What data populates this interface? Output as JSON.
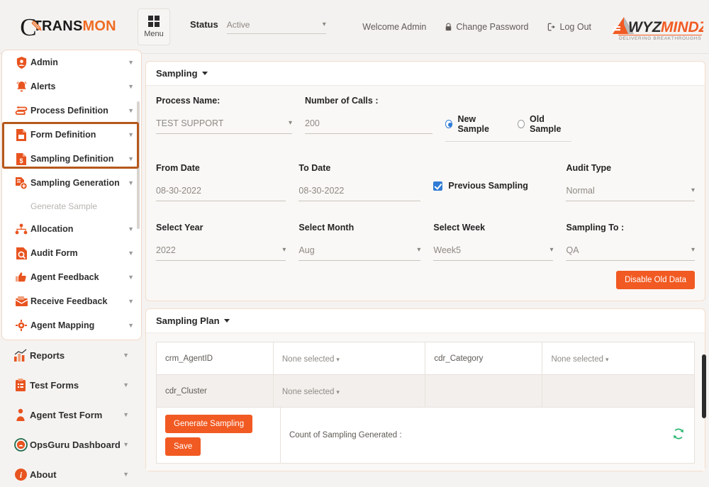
{
  "header": {
    "logo": {
      "mark": "C",
      "text_dark": "TRANS",
      "text_accent": "MON"
    },
    "menu_label": "Menu",
    "status_label": "Status",
    "status_value": "Active",
    "welcome": "Welcome Admin",
    "change_password": "Change Password",
    "log_out": "Log Out",
    "brand_logo": {
      "name_dark": "WYZ",
      "name_accent": "MINDZ",
      "tagline": "DELIVERING  BREAKTHROUGHS"
    }
  },
  "sidebar": {
    "items": [
      {
        "label": "Admin",
        "icon": "shield-user-icon"
      },
      {
        "label": "Alerts",
        "icon": "bell-icon"
      },
      {
        "label": "Process Definition",
        "icon": "process-arrows-icon"
      },
      {
        "label": "Form Definition",
        "icon": "form-document-icon"
      },
      {
        "label": "Sampling Definition",
        "icon": "dollar-document-icon"
      },
      {
        "label": "Sampling Generation",
        "icon": "document-plus-icon"
      },
      {
        "label": "Allocation",
        "icon": "hierarchy-icon"
      },
      {
        "label": "Audit Form",
        "icon": "audit-magnifier-icon"
      },
      {
        "label": "Agent Feedback",
        "icon": "thumbs-up-icon"
      },
      {
        "label": "Receive Feedback",
        "icon": "inbox-feedback-icon"
      },
      {
        "label": "Agent Mapping",
        "icon": "gear-icon"
      }
    ],
    "sub_item": "Generate Sample",
    "lower_items": [
      {
        "label": "Reports",
        "icon": "bar-chart-icon"
      },
      {
        "label": "Test Forms",
        "icon": "clipboard-check-icon"
      },
      {
        "label": "Agent Test Form",
        "icon": "person-icon"
      },
      {
        "label": "OpsGuru Dashboard",
        "icon": "dashboard-circle-icon"
      },
      {
        "label": "About",
        "icon": "info-icon"
      }
    ]
  },
  "sampling": {
    "panel_title": "Sampling",
    "process_name": {
      "label": "Process Name:",
      "value": "TEST SUPPORT"
    },
    "number_of_calls": {
      "label": "Number of Calls :",
      "value": "200"
    },
    "sample_type": {
      "new_label": "New Sample",
      "old_label": "Old Sample",
      "selected": "New Sample"
    },
    "from_date": {
      "label": "From Date",
      "value": "08-30-2022"
    },
    "to_date": {
      "label": "To Date",
      "value": "08-30-2022"
    },
    "previous_sampling": {
      "label": "Previous Sampling",
      "checked": true
    },
    "audit_type": {
      "label": "Audit Type",
      "value": "Normal"
    },
    "select_year": {
      "label": "Select Year",
      "value": "2022"
    },
    "select_month": {
      "label": "Select Month",
      "value": "Aug"
    },
    "select_week": {
      "label": "Select Week",
      "value": "Week5"
    },
    "sampling_to": {
      "label": "Sampling To :",
      "value": "QA"
    },
    "disable_old_data": "Disable Old Data"
  },
  "sampling_plan": {
    "panel_title": "Sampling Plan",
    "rows": [
      {
        "key1": "crm_AgentID",
        "val1": "None selected",
        "key2": "cdr_Category",
        "val2": "None selected"
      },
      {
        "key1": "cdr_Cluster",
        "val1": "None selected",
        "key2": "",
        "val2": ""
      }
    ],
    "generate_button": "Generate Sampling",
    "save_button": "Save",
    "count_label": "Count of Sampling Generated :"
  },
  "colors": {
    "accent_orange": "#f15a22",
    "highlight_border": "#b5581c",
    "radio_blue": "#2f7bd6",
    "refresh_green": "#2eb872"
  }
}
